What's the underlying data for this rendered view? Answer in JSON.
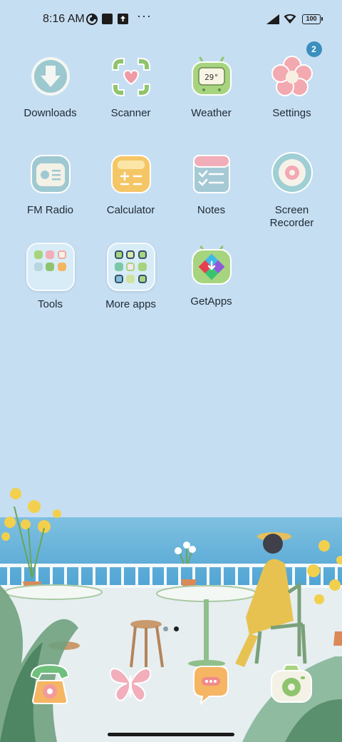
{
  "status_bar": {
    "time": "8:16 AM",
    "battery": "100",
    "icons": [
      "data-saver-icon",
      "square-notification-icon",
      "upload-icon",
      "more-dots-icon",
      "signal-icon",
      "wifi-icon",
      "battery-icon"
    ],
    "overflow": "···"
  },
  "apps": [
    {
      "label": "Downloads",
      "icon": "downloads-icon"
    },
    {
      "label": "Scanner",
      "icon": "scanner-icon"
    },
    {
      "label": "Weather",
      "icon": "weather-icon",
      "temp": "29°"
    },
    {
      "label": "Settings",
      "icon": "settings-flower-icon",
      "badge": "2"
    },
    {
      "label": "FM Radio",
      "icon": "radio-icon"
    },
    {
      "label": "Calculator",
      "icon": "calculator-icon"
    },
    {
      "label": "Notes",
      "icon": "notes-icon"
    },
    {
      "label": "Screen Recorder",
      "icon": "screen-recorder-icon"
    },
    {
      "label": "Tools",
      "icon": "tools-folder-icon"
    },
    {
      "label": "More apps",
      "icon": "more-apps-folder-icon"
    },
    {
      "label": "GetApps",
      "icon": "getapps-icon"
    }
  ],
  "page_indicator": {
    "pages": 2,
    "current": 2
  },
  "dock": [
    {
      "icon": "phone-icon"
    },
    {
      "icon": "gallery-butterfly-icon"
    },
    {
      "icon": "messages-icon"
    },
    {
      "icon": "camera-icon"
    }
  ],
  "colors": {
    "background": "#c6def2",
    "badge": "#3b8fbd",
    "label": "#1e2a33"
  }
}
